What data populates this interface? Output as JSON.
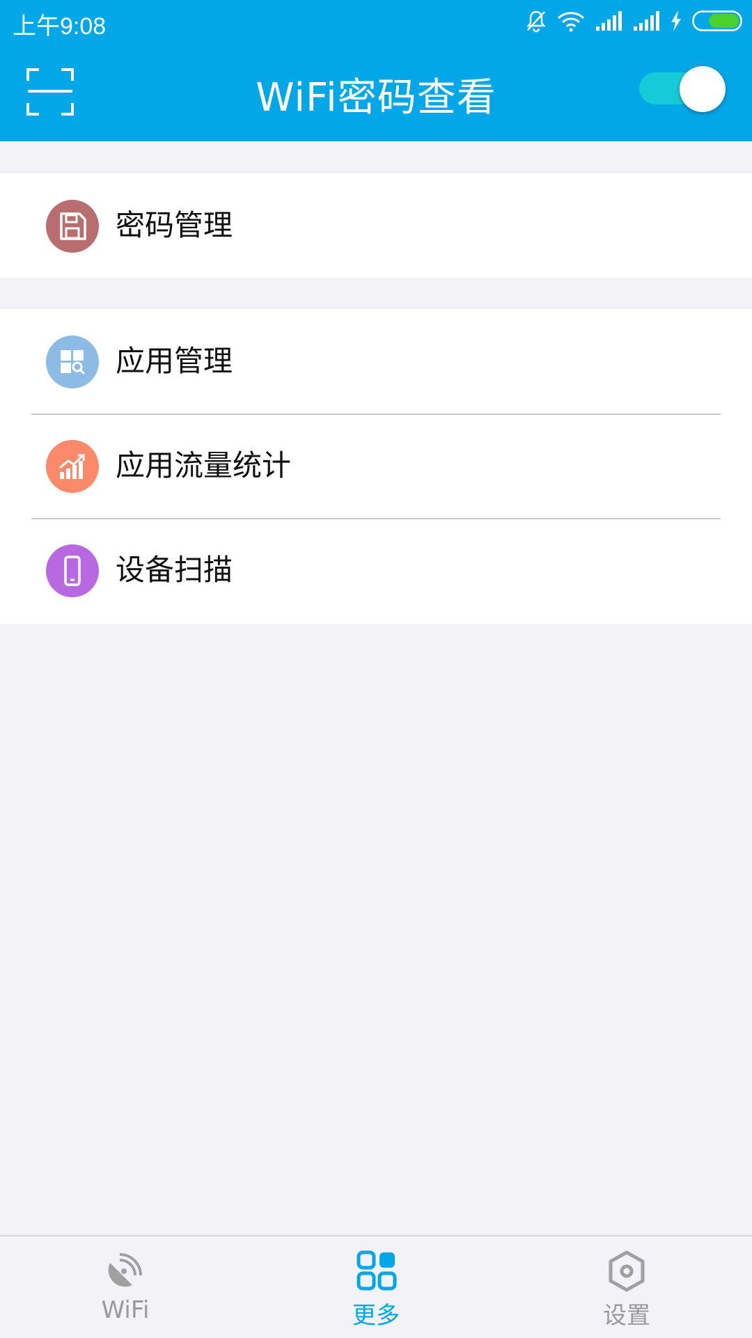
{
  "status_bar": {
    "time": "上午9:08",
    "icons": [
      "mute-bell-icon",
      "wifi-signal-icon",
      "cell-signal-icon",
      "cell-signal-icon",
      "charging-bolt-icon",
      "battery-icon"
    ]
  },
  "app_bar": {
    "title": "WiFi密码查看",
    "left_icon": "scan-frame-icon",
    "toggle_on": true
  },
  "groups": [
    {
      "items": [
        {
          "label": "密码管理",
          "icon": "floppy-disk-icon",
          "color": "#B86E6E"
        }
      ]
    },
    {
      "items": [
        {
          "label": "应用管理",
          "icon": "app-grid-search-icon",
          "color": "#8CBBE3"
        },
        {
          "label": "应用流量统计",
          "icon": "traffic-chart-icon",
          "color": "#FB8A6A"
        },
        {
          "label": "设备扫描",
          "icon": "phone-device-icon",
          "color": "#B868E0"
        }
      ]
    }
  ],
  "bottom_nav": {
    "items": [
      {
        "label": "WiFi",
        "icon": "satellite-dish-icon",
        "active": false
      },
      {
        "label": "更多",
        "icon": "four-squares-icon",
        "active": true
      },
      {
        "label": "设置",
        "icon": "hexagon-settings-icon",
        "active": false
      }
    ],
    "active_color": "#02A7E8",
    "inactive_color": "#9A9A9A"
  },
  "colors": {
    "primary": "#02A7E8",
    "toggle_track": "#16CBD7",
    "background": "#F2F2F7"
  }
}
